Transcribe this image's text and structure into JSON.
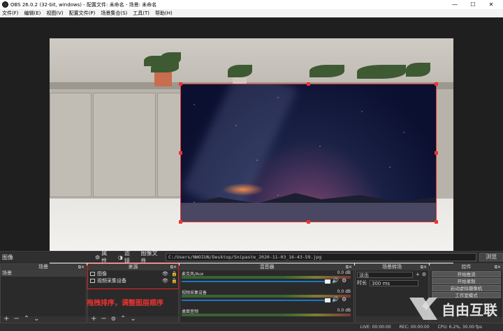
{
  "window": {
    "title": "OBS 26.0.2 (32-bit, windows) - 配置文件: 未命名 - 场景: 未命名",
    "minimize": "—",
    "maximize": "☐",
    "close": "✕"
  },
  "menu": [
    "文件(F)",
    "编辑(E)",
    "视图(V)",
    "配置文件(P)",
    "场景集合(S)",
    "工具(T)",
    "帮助(H)"
  ],
  "source_bar": {
    "current_source": "图像",
    "properties": "属性",
    "filters": "滤镜",
    "image_file_label": "图像文件",
    "path": "C:/Users/NWOIUN/Desktop/Snipaste_2020-11-03_16-43-59.jpg",
    "browse": "浏览"
  },
  "docks": {
    "scenes": {
      "title": "场景",
      "items": [
        "场景"
      ]
    },
    "sources": {
      "title": "来源",
      "items": [
        {
          "label": "图像",
          "icon": "image-icon"
        },
        {
          "label": "视频采集设备",
          "icon": "camera-icon"
        }
      ]
    },
    "mixer": {
      "title": "混音器",
      "channels": [
        {
          "name": "麦克风/Aux",
          "db": "0.0 dB"
        },
        {
          "name": "视频采集设备",
          "db": "0.0 dB"
        },
        {
          "name": "桌面音频",
          "db": "0.0 dB"
        }
      ]
    },
    "transitions": {
      "title": "场景转场",
      "type": "淡出",
      "duration_label": "时长",
      "duration": "300 ms"
    },
    "controls": {
      "title": "控件",
      "buttons": [
        "开始推流",
        "开始录制",
        "启动虚拟摄像机",
        "工作室模式"
      ]
    }
  },
  "annotation": "拖拽排序，调整图层顺序",
  "status": {
    "live": "LIVE: 00:00:00",
    "rec": "REC: 00:00:00",
    "cpu": "CPU: 6.2%, 30.00 fps"
  },
  "watermark": "自由互联",
  "colors": {
    "accent_red": "#e33333",
    "slider_blue": "#1d76c8"
  }
}
